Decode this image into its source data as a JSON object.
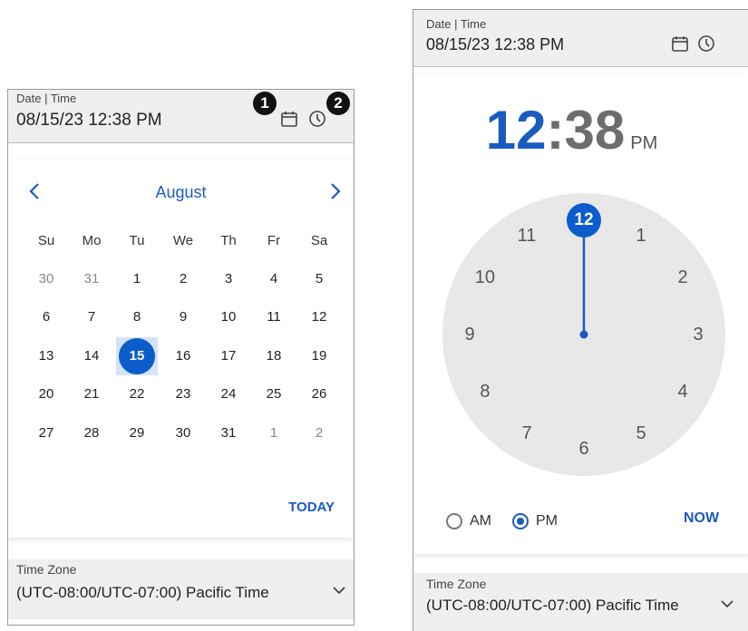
{
  "datetime_field": {
    "label": "Date | Time",
    "value": "08/15/23 12:38 PM"
  },
  "callouts": {
    "one": "1",
    "two": "2"
  },
  "calendar": {
    "month": "August",
    "weekdays": [
      "Su",
      "Mo",
      "Tu",
      "We",
      "Th",
      "Fr",
      "Sa"
    ],
    "weeks": [
      [
        "30",
        "31",
        "1",
        "2",
        "3",
        "4",
        "5"
      ],
      [
        "6",
        "7",
        "8",
        "9",
        "10",
        "11",
        "12"
      ],
      [
        "13",
        "14",
        "15",
        "16",
        "17",
        "18",
        "19"
      ],
      [
        "20",
        "21",
        "22",
        "23",
        "24",
        "25",
        "26"
      ],
      [
        "27",
        "28",
        "29",
        "30",
        "31",
        "1",
        "2"
      ]
    ],
    "selected": "15",
    "today_label": "TODAY"
  },
  "time_picker": {
    "hour": "12",
    "minute": "38",
    "period": "PM",
    "clock_numbers": [
      "12",
      "1",
      "2",
      "3",
      "4",
      "5",
      "6",
      "7",
      "8",
      "9",
      "10",
      "11"
    ],
    "am_label": "AM",
    "pm_label": "PM",
    "selected_period": "PM",
    "now_label": "NOW"
  },
  "timezone_field": {
    "label": "Time Zone",
    "value": "(UTC-08:00/UTC-07:00) Pacific Time"
  },
  "colors": {
    "accent": "#1a5bbf",
    "selected_fill": "#0d5ccc",
    "selected_highlight": "#d4e3f7",
    "clock_face": "#e8e8e8"
  },
  "icons": [
    "calendar-icon",
    "clock-icon",
    "chevron-left-icon",
    "chevron-right-icon",
    "chevron-down-icon"
  ]
}
